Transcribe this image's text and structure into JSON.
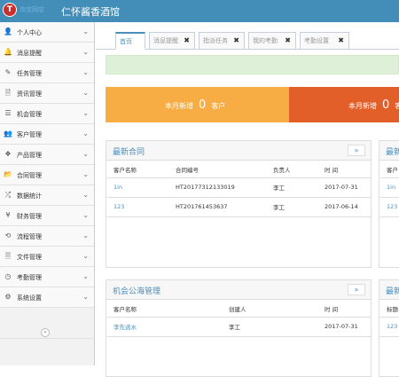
{
  "header": {
    "logo_glyph": "T",
    "logo_text": "淘宝网店",
    "title": "仁怀酱香酒馆"
  },
  "sidebar": {
    "items": [
      {
        "icon": "user-icon",
        "glyph": "👤",
        "label": "个人中心"
      },
      {
        "icon": "bell-icon",
        "glyph": "🔔",
        "label": "消息提醒"
      },
      {
        "icon": "edit-icon",
        "glyph": "✎",
        "label": "任务管理"
      },
      {
        "icon": "file-icon",
        "glyph": "🗎",
        "label": "资讯管理"
      },
      {
        "icon": "list-icon",
        "glyph": "☰",
        "label": "机会管理"
      },
      {
        "icon": "users-icon",
        "glyph": "👥",
        "label": "客户管理"
      },
      {
        "icon": "dropbox-icon",
        "glyph": "❖",
        "label": "产品管理"
      },
      {
        "icon": "folder-icon",
        "glyph": "📂",
        "label": "合同管理"
      },
      {
        "icon": "random-icon",
        "glyph": "⤮",
        "label": "数据统计"
      },
      {
        "icon": "yen-icon",
        "glyph": "¥",
        "label": "财务管理"
      },
      {
        "icon": "retweet-icon",
        "glyph": "⟲",
        "label": "流程管理"
      },
      {
        "icon": "file-text-icon",
        "glyph": "🗏",
        "label": "文件管理"
      },
      {
        "icon": "clock-icon",
        "glyph": "◷",
        "label": "考勤管理"
      },
      {
        "icon": "gear-icon",
        "glyph": "⚙",
        "label": "系统设置"
      }
    ],
    "collapse_glyph": "«"
  },
  "tabs": [
    {
      "label": "首页",
      "active": true
    },
    {
      "label": "消息提醒",
      "active": false
    },
    {
      "label": "指派任务",
      "active": false
    },
    {
      "label": "我的考勤",
      "active": false
    },
    {
      "label": "考勤设置",
      "active": false
    }
  ],
  "close_glyph": "✖",
  "stats": [
    {
      "prefix": "本月新增",
      "value": "0",
      "suffix": "客户",
      "color": "#f7ad43"
    },
    {
      "prefix": "本月新增",
      "value": "0",
      "suffix": "客户",
      "color": "#e35f2a"
    }
  ],
  "contracts": {
    "title": "最新合同",
    "more": "»",
    "columns": [
      "客户名称",
      "合同编号",
      "负责人",
      "时 间"
    ],
    "rows": [
      [
        "1in",
        "HT20177312133019",
        "李工",
        "2017-07-31"
      ],
      [
        "123",
        "HT201761453637",
        "李工",
        "2017-06-14"
      ]
    ]
  },
  "right_panel_top": {
    "title": "最新",
    "columns": [
      "客户"
    ],
    "rows": [
      [
        "1in"
      ],
      [
        "123"
      ]
    ]
  },
  "opportunities": {
    "title": "机会公海管理",
    "more": "»",
    "columns": [
      "客户名称",
      "创建人",
      "时 间"
    ],
    "rows": [
      [
        "李先逃水",
        "李工",
        "2017-07-31"
      ]
    ]
  },
  "right_panel_bottom": {
    "title": "最新",
    "columns": [
      "标题"
    ],
    "rows": [
      [
        "123"
      ]
    ]
  }
}
